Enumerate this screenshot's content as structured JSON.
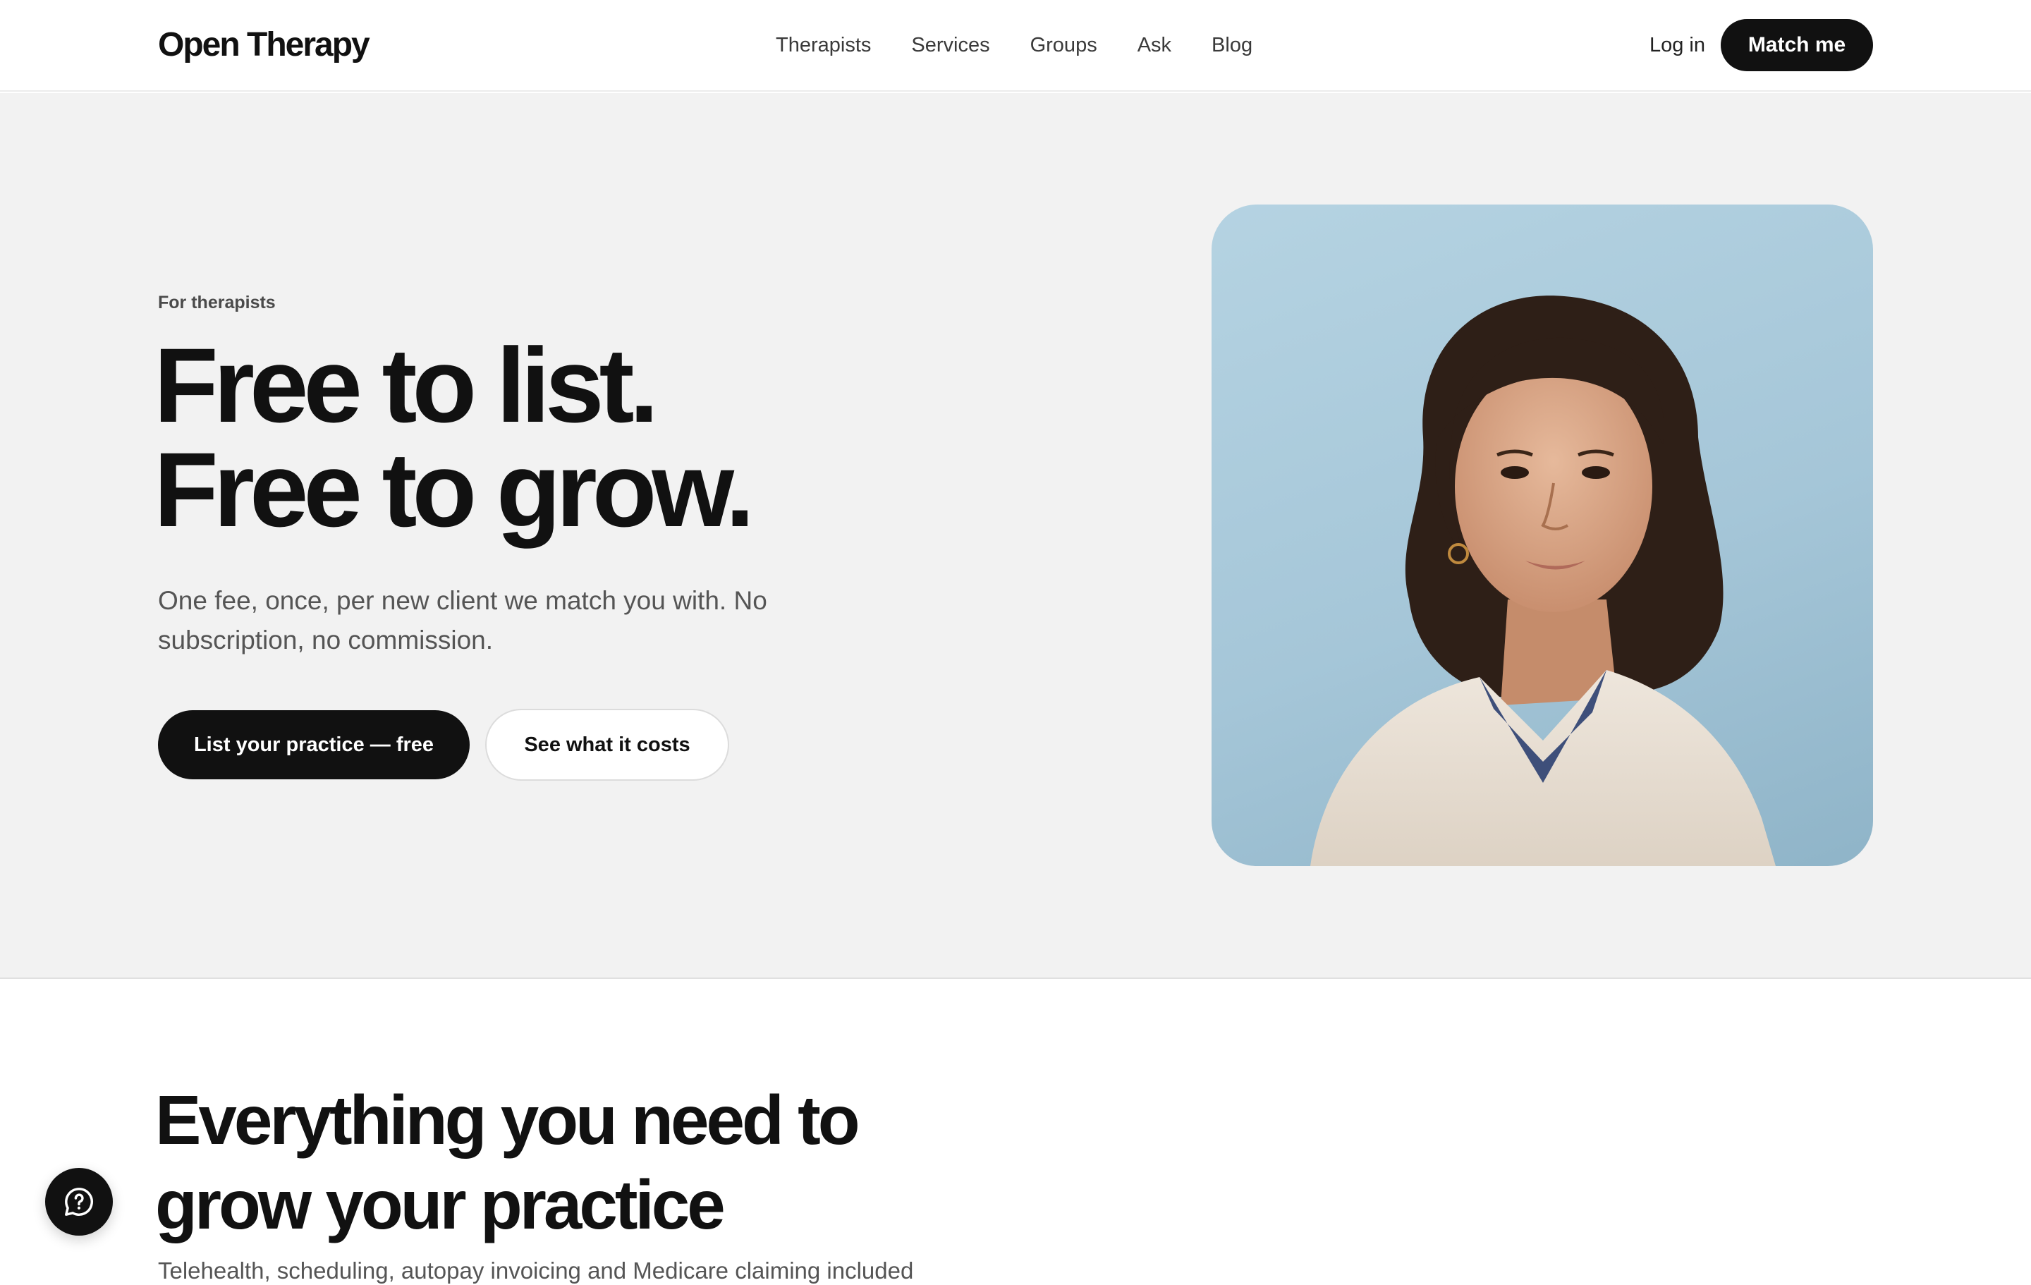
{
  "nav": {
    "brand": "Open Therapy",
    "links": [
      "Therapists",
      "Services",
      "Groups",
      "Ask",
      "Blog"
    ],
    "login_label": "Log in",
    "cta_label": "Match me"
  },
  "hero": {
    "eyebrow": "For therapists",
    "headline_line1": "Free to list.",
    "headline_line2": "Free to grow.",
    "subtext": "One fee, once, per new client we match you with. No subscription, no commission.",
    "primary_cta": "List your practice — free",
    "secondary_cta": "See what it costs",
    "image": "portrait-photo"
  },
  "section2": {
    "title_line1": "Everything you need to",
    "title_line2": "grow your practice",
    "subtext": "Telehealth, scheduling, autopay invoicing and Medicare claiming included"
  },
  "help_fab": {
    "icon": "help-chat-icon"
  },
  "colors": {
    "primary": "#111111",
    "hero_bg": "#f2f2f2",
    "photo_bg": "#aecbdb"
  }
}
